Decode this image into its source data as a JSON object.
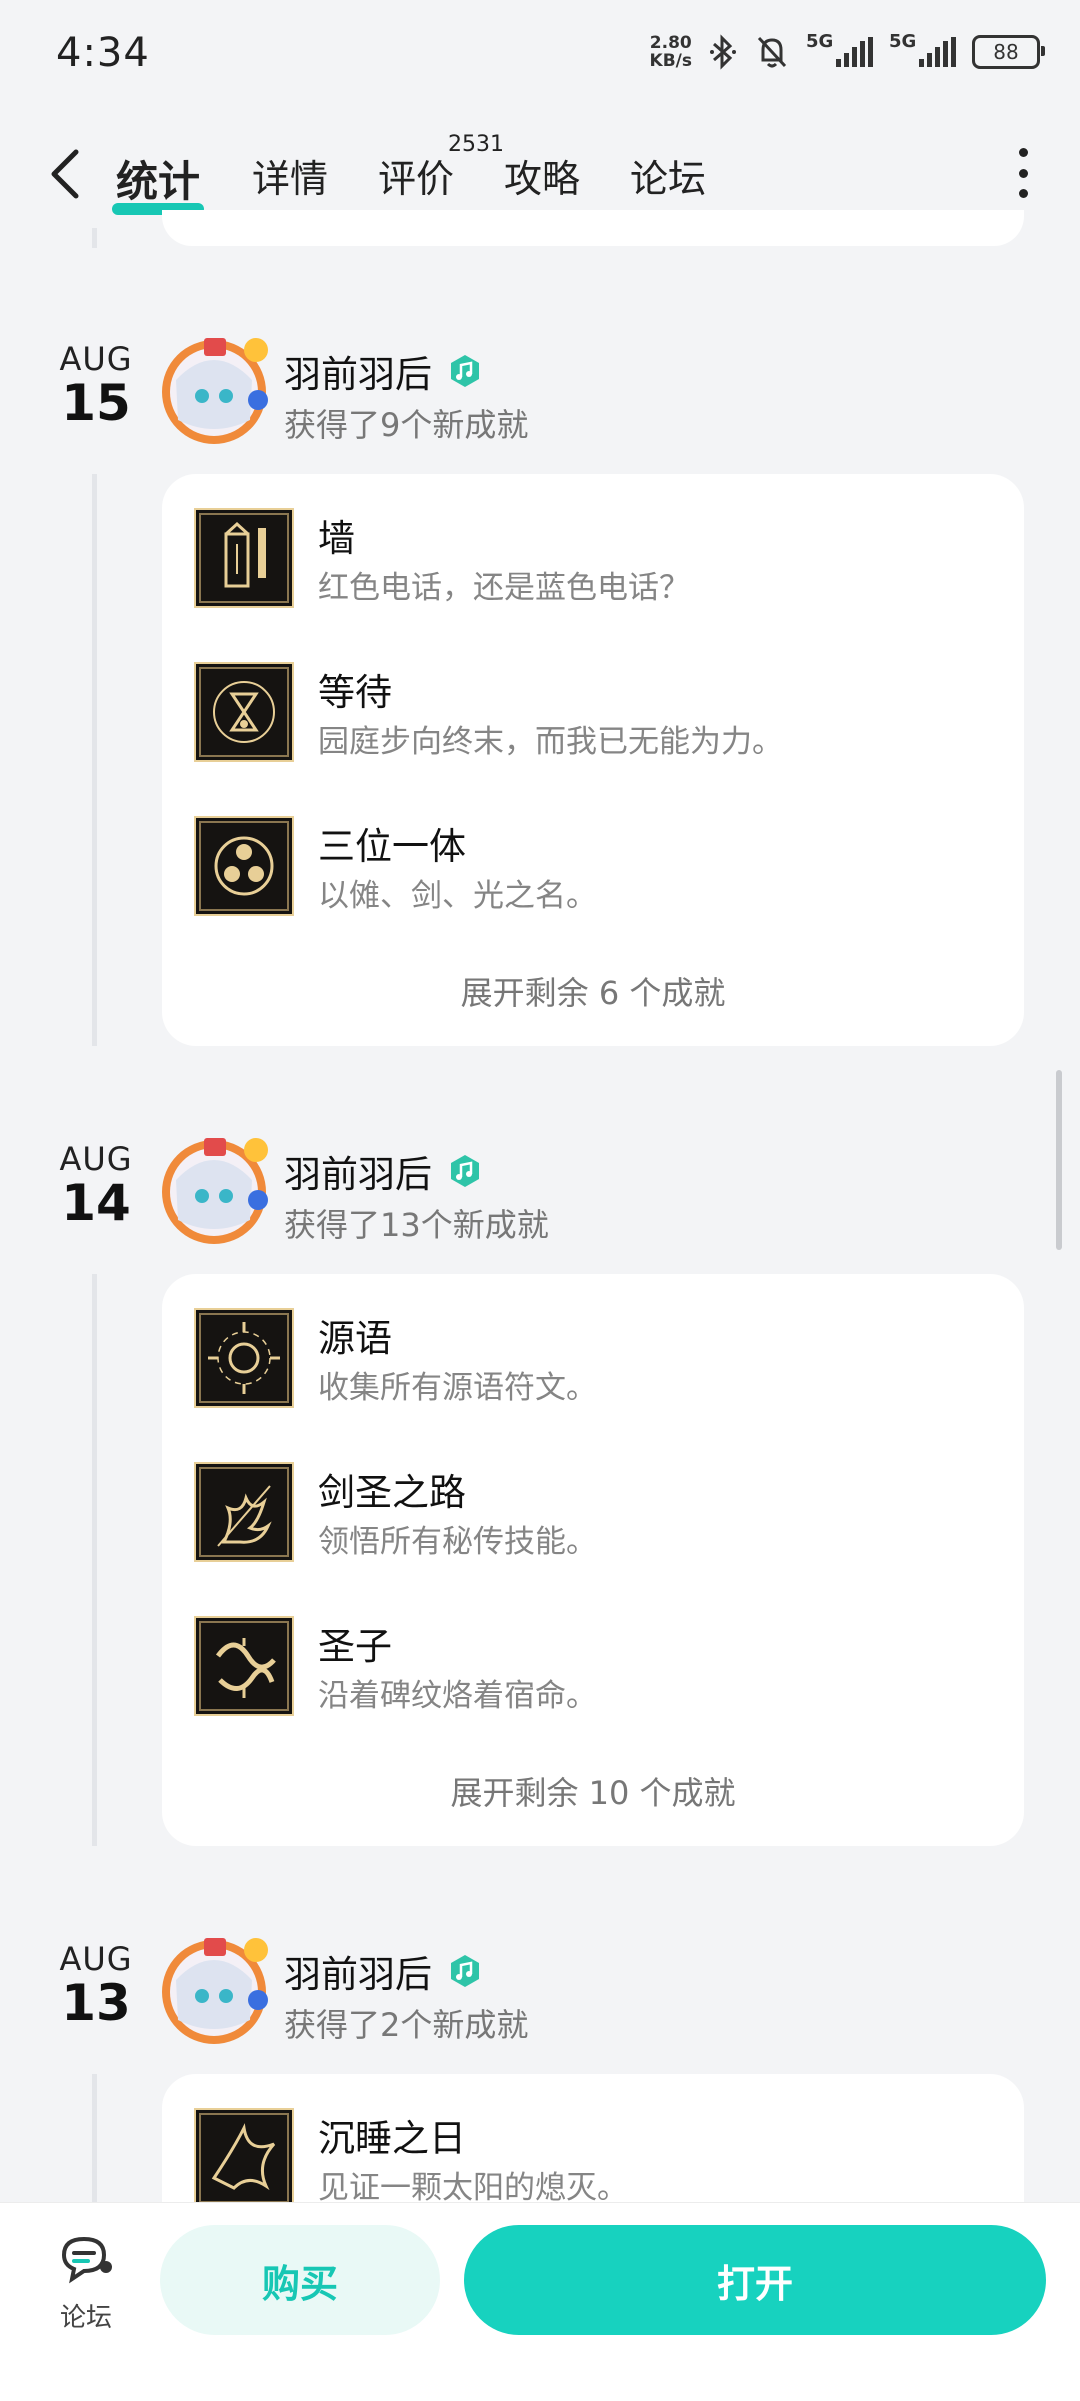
{
  "status_bar": {
    "time": "4:34",
    "net_speed_value": "2.80",
    "net_speed_unit": "KB/s",
    "signal1_label": "5G",
    "signal2_label": "5G",
    "battery": "88"
  },
  "nav": {
    "tabs": [
      {
        "label": "统计",
        "active": true
      },
      {
        "label": "详情"
      },
      {
        "label": "评价"
      },
      {
        "label": "攻略"
      },
      {
        "label": "论坛"
      }
    ],
    "review_count": "2531"
  },
  "timeline": [
    {
      "month": "AUG",
      "day": "15",
      "user": "羽前羽后",
      "summary": "获得了9个新成就",
      "achievements": [
        {
          "title": "墙",
          "desc": "红色电话，还是蓝色电话？",
          "icon": "phone-booth-icon"
        },
        {
          "title": "等待",
          "desc": "园庭步向终末，而我已无能为力。",
          "icon": "hourglass-icon"
        },
        {
          "title": "三位一体",
          "desc": "以傩、剑、光之名。",
          "icon": "triad-emblem-icon"
        }
      ],
      "expand_label": "展开剩余 6 个成就"
    },
    {
      "month": "AUG",
      "day": "14",
      "user": "羽前羽后",
      "summary": "获得了13个新成就",
      "achievements": [
        {
          "title": "源语",
          "desc": "收集所有源语符文。",
          "icon": "rune-sun-icon"
        },
        {
          "title": "剑圣之路",
          "desc": "领悟所有秘传技能。",
          "icon": "sword-flame-icon"
        },
        {
          "title": "圣子",
          "desc": "沿着碑纹烙着宿命。",
          "icon": "sacred-knot-icon"
        }
      ],
      "expand_label": "展开剩余 10 个成就"
    },
    {
      "month": "AUG",
      "day": "13",
      "user": "羽前羽后",
      "summary": "获得了2个新成就",
      "achievements": [
        {
          "title": "沉睡之日",
          "desc": "见证一颗太阳的熄灭。",
          "icon": "bird-sun-icon"
        }
      ]
    }
  ],
  "bottom": {
    "forum_label": "论坛",
    "buy_label": "购买",
    "open_label": "打开"
  },
  "colors": {
    "accent": "#17c7b4",
    "background": "#f3f4f6",
    "icon_gold": "#e8cf97",
    "icon_bg": "#151311"
  }
}
